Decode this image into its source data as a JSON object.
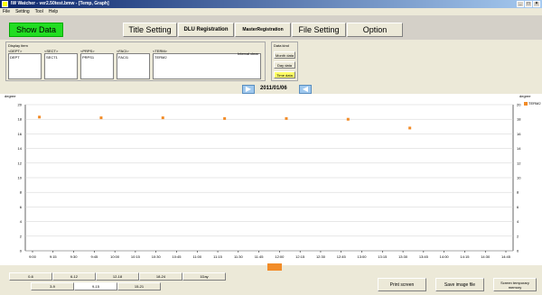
{
  "window": {
    "title": "IW Watcher - ver2.50test.bmw - [Temp, Graph]"
  },
  "menu": {
    "items": [
      "File",
      "Setting",
      "Tool",
      "Help"
    ]
  },
  "toolbar": {
    "show_data": "Show Data",
    "title_setting": "Title Setting",
    "dlu_registration": "DLU Registration",
    "master_registration": "MasterRegistration",
    "file_setting": "File Setting",
    "option": "Option"
  },
  "display_item": {
    "label": "Display item",
    "fields": [
      {
        "header": "<DEPT>",
        "value": "DEPT"
      },
      {
        "header": "<SECT>",
        "value": "SECT1"
      },
      {
        "header": "<PRPS>",
        "value": "PRPS1"
      },
      {
        "header": "<FACI>",
        "value": "FACI1"
      },
      {
        "header": "<TERM>",
        "value": "TERM2"
      }
    ],
    "interval_label": "Interval clear"
  },
  "data_kind": {
    "label": "Data kind",
    "buttons": [
      "Month data",
      "Day data",
      "Time data"
    ],
    "selected": "Time data"
  },
  "navigation": {
    "date": "2011/01/06"
  },
  "chart_data": {
    "type": "scatter",
    "ylabel": "degree",
    "ylim": [
      0,
      20
    ],
    "yticks": [
      0,
      2,
      4,
      6,
      8,
      10,
      12,
      14,
      16,
      18,
      20
    ],
    "xticks": [
      "9:00",
      "9:15",
      "9:30",
      "9:45",
      "10:00",
      "10:15",
      "10:30",
      "10:45",
      "11:00",
      "11:15",
      "11:30",
      "11:45",
      "12:00",
      "12:15",
      "12:30",
      "12:45",
      "13:00",
      "13:15",
      "13:30",
      "13:45",
      "14:00",
      "14:15",
      "14:30",
      "14:45"
    ],
    "series": [
      {
        "name": "TERM2",
        "color": "#f28c28",
        "points": [
          {
            "x": "9:05",
            "y": 18.3
          },
          {
            "x": "9:50",
            "y": 18.2
          },
          {
            "x": "10:35",
            "y": 18.2
          },
          {
            "x": "11:20",
            "y": 18.1
          },
          {
            "x": "12:05",
            "y": 18.1
          },
          {
            "x": "12:50",
            "y": 18.0
          },
          {
            "x": "13:35",
            "y": 16.8
          }
        ]
      }
    ],
    "grid": true,
    "legend_position": "right"
  },
  "time_ranges": {
    "row1": [
      "0-6",
      "6-12",
      "12-18",
      "18-24",
      "1Day"
    ],
    "row2": [
      "3-9",
      "9-15",
      "15-21"
    ]
  },
  "actions": {
    "print": "Print screen",
    "save": "Save image file",
    "display_memory": "Screen temporary memory"
  }
}
